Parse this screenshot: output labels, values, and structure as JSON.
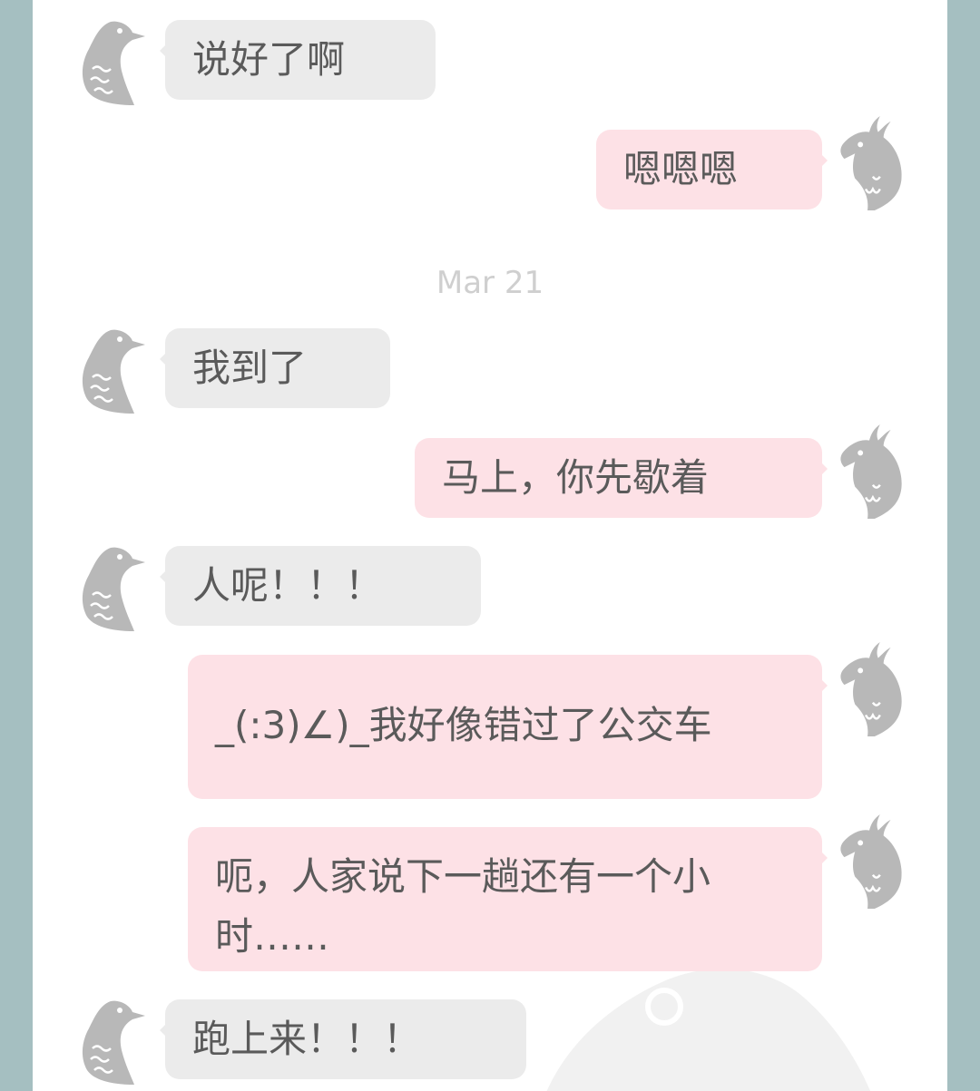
{
  "date_separator": "Mar 21",
  "messages": [
    {
      "side": "in",
      "text": "说好了啊",
      "avatar": "pigeon-icon"
    },
    {
      "side": "out",
      "text": "嗯嗯嗯",
      "avatar": "cockatiel-icon"
    },
    {
      "side": "in",
      "text": "我到了",
      "avatar": "pigeon-icon"
    },
    {
      "side": "out",
      "text": "马上，你先歇着",
      "avatar": "cockatiel-icon"
    },
    {
      "side": "in",
      "text": "人呢！！！",
      "avatar": "pigeon-icon"
    },
    {
      "side": "out",
      "text": "_(:3)∠)_我好像错过了公交车",
      "avatar": "cockatiel-icon"
    },
    {
      "side": "out",
      "text": "呃，人家说下一趟还有一个小时……",
      "avatar": "cockatiel-icon"
    },
    {
      "side": "in",
      "text": "跑上来！！！",
      "avatar": "pigeon-icon"
    }
  ],
  "colors": {
    "frame": "#a5bfc1",
    "incoming_bubble": "#ebebeb",
    "outgoing_bubble": "#fde1e6",
    "text": "#5a5a5a",
    "avatar": "#b8b8b8"
  }
}
